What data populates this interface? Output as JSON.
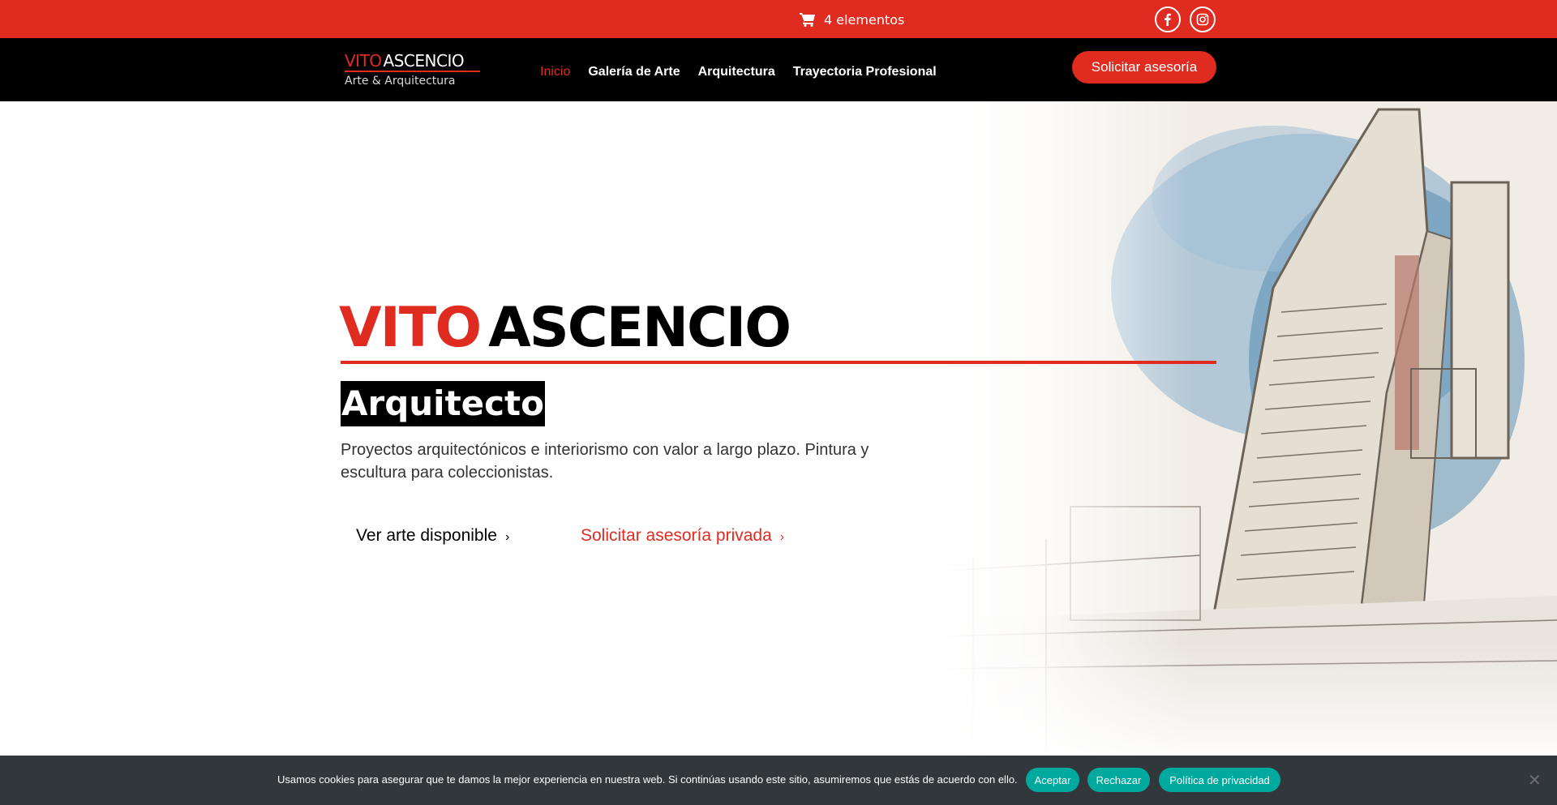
{
  "topbar": {
    "cart_label": "4 elementos",
    "cart_icon": "cart-icon",
    "social": [
      "facebook-icon",
      "instagram-icon"
    ]
  },
  "header": {
    "logo": {
      "first": "VITO",
      "last": "ASCENCIO",
      "sub": "Arte & Arquitectura"
    },
    "nav": [
      {
        "label": "Inicio",
        "active": true
      },
      {
        "label": "Galería de Arte"
      },
      {
        "label": "Arquitectura"
      },
      {
        "label": "Trayectoria Profesional"
      }
    ],
    "cta": "Solicitar asesoría"
  },
  "hero": {
    "title_first": "VITO",
    "title_last": "ASCENCIO",
    "role": "Arquitecto",
    "intro": "Proyectos arquitectónicos e interiorismo con valor a largo plazo. Pintura y escultura para coleccionistas.",
    "primary_link": "Ver arte disponible",
    "secondary_link": "Solicitar asesoría privada",
    "chevron": "›"
  },
  "cookie": {
    "text": "Usamos cookies para asegurar que te damos la mejor experiencia en nuestra web. Si continúas usando este sitio, asumiremos que estás de acuerdo con ello.",
    "accept": "Aceptar",
    "reject": "Rechazar",
    "privacy": "Política de privacidad",
    "close": "✕"
  },
  "colors": {
    "brand_red": "#e02b20",
    "cookie_bg": "#32373c",
    "cookie_btn": "#00a99d"
  }
}
